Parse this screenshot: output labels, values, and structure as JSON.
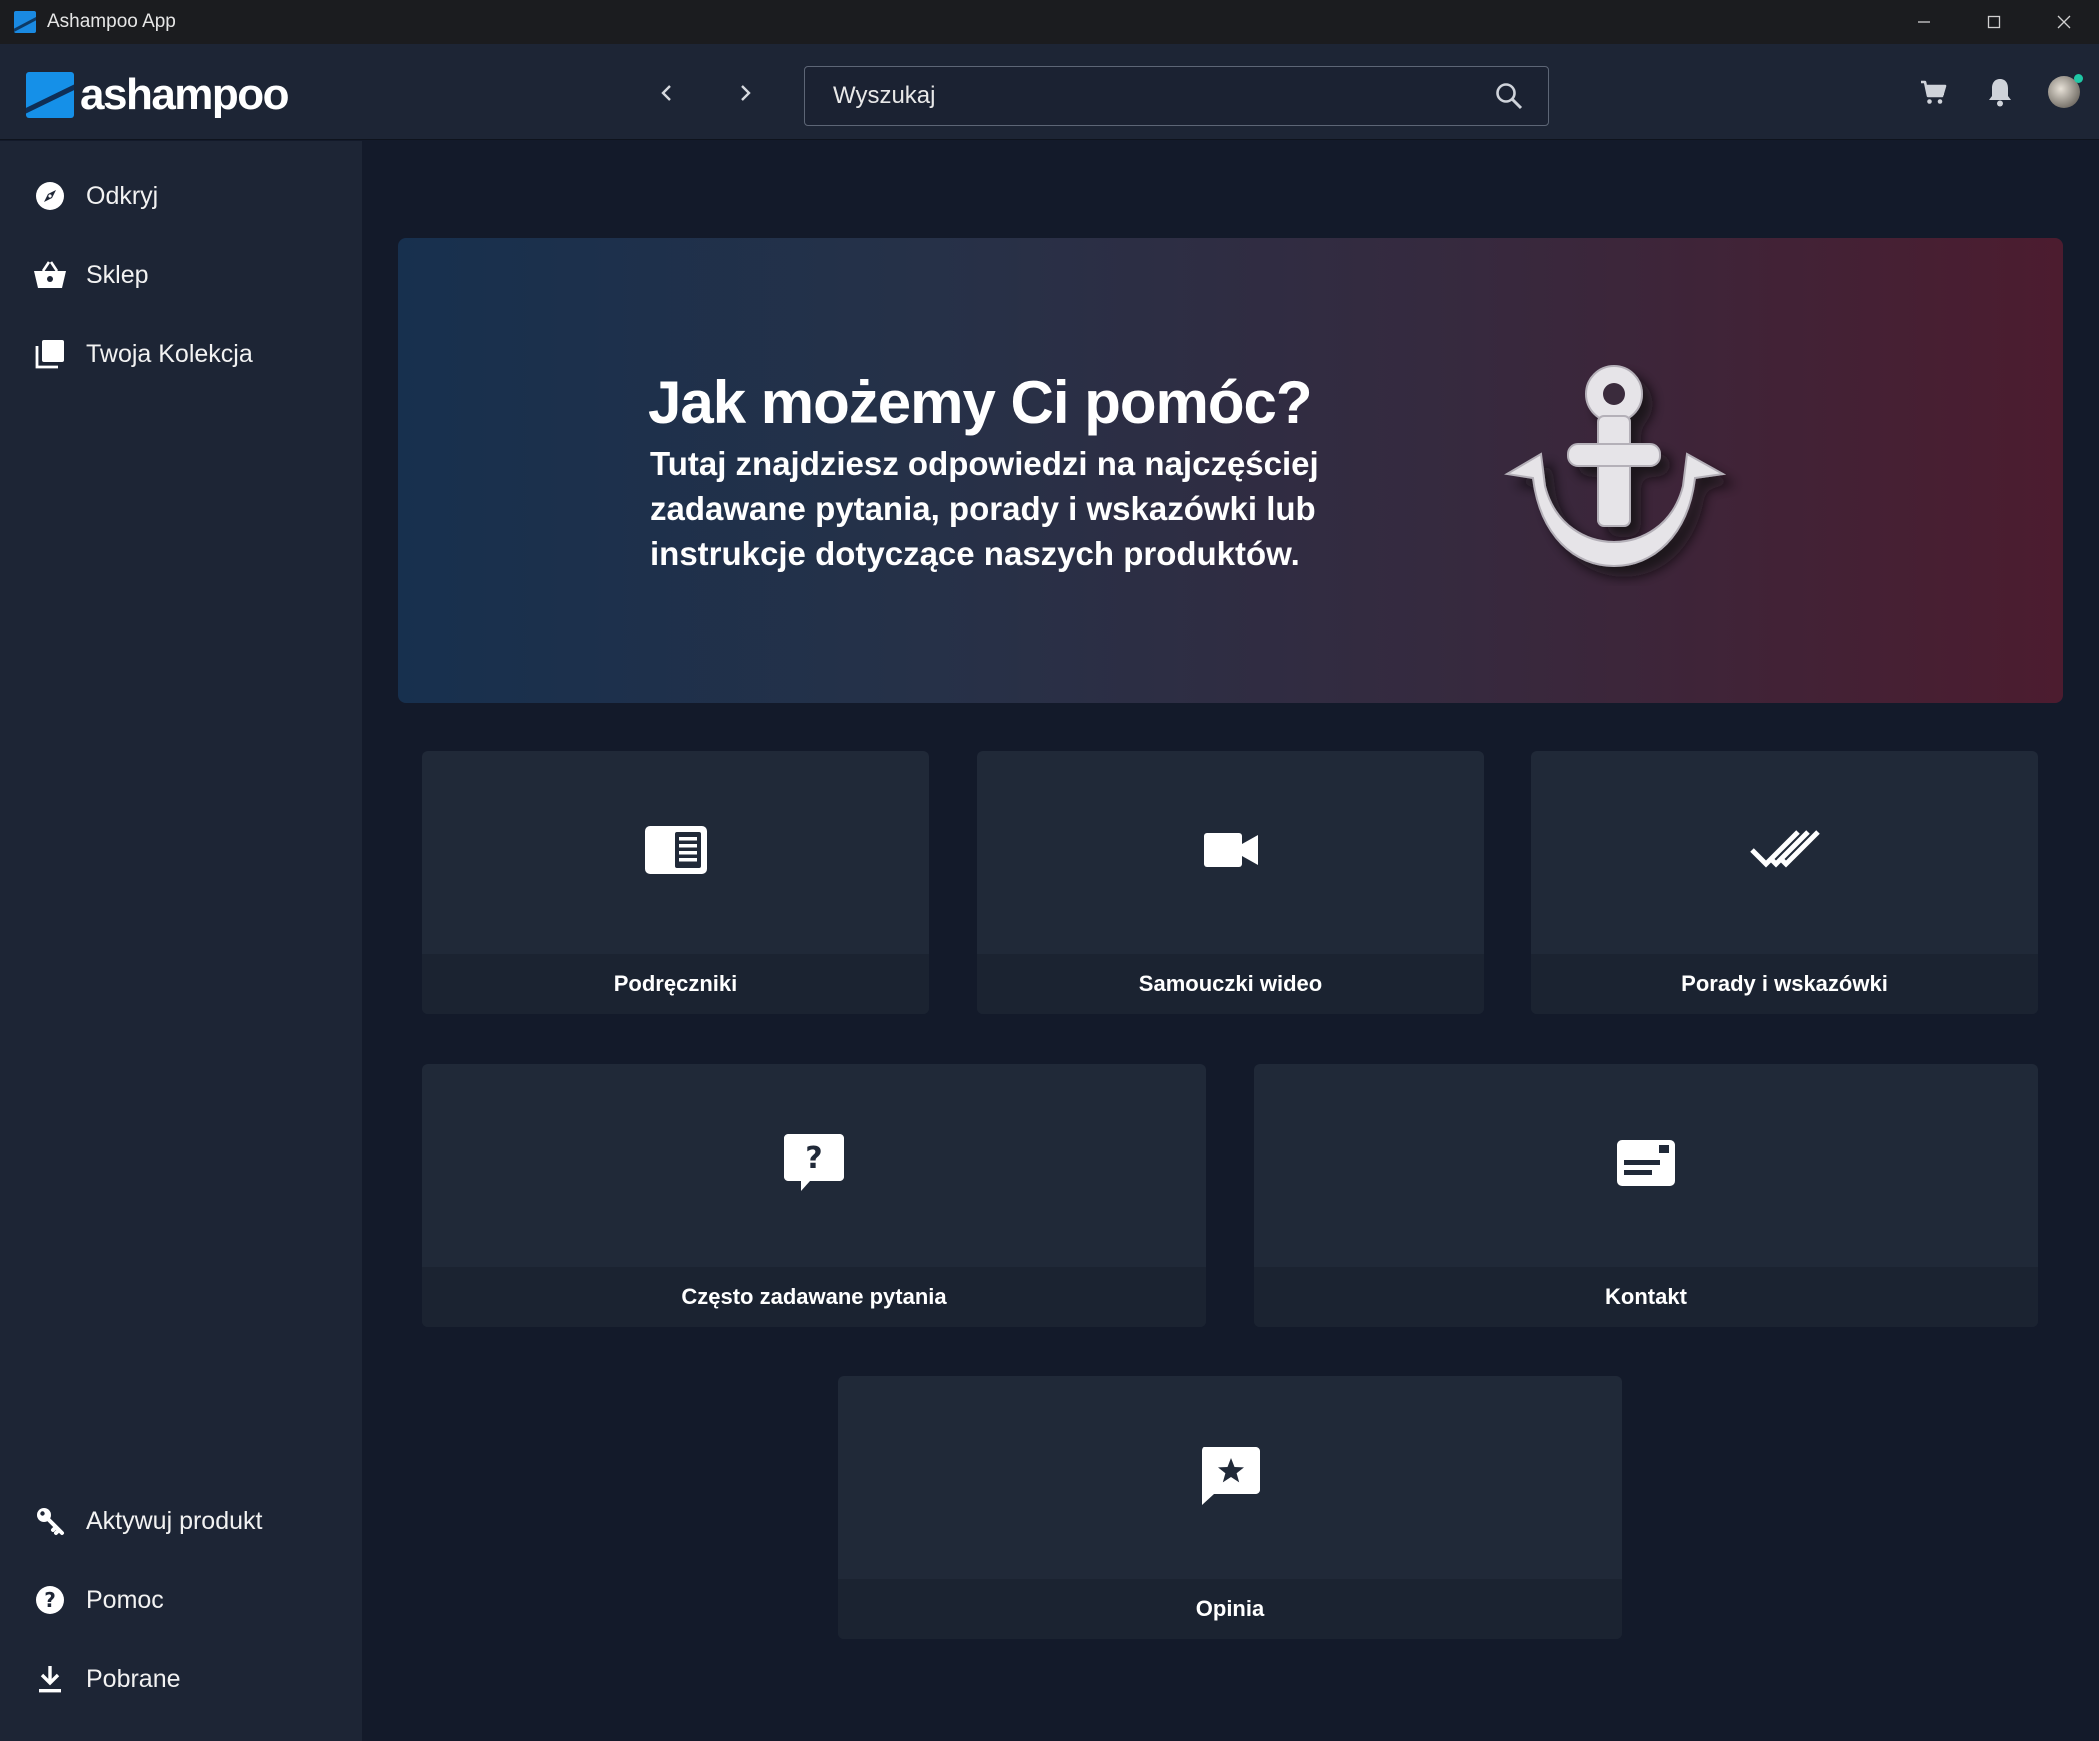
{
  "window": {
    "title": "Ashampoo App",
    "controls": [
      "minimize-icon",
      "maximize-icon",
      "close-icon"
    ]
  },
  "header": {
    "logo_text": "ashampoo",
    "search": {
      "placeholder": "Wyszukaj",
      "value": ""
    },
    "icons": [
      "back-arrow-icon",
      "forward-arrow-icon",
      "search-icon",
      "cart-icon",
      "bell-icon",
      "avatar"
    ]
  },
  "sidebar": {
    "top_items": [
      {
        "label": "Odkryj",
        "icon": "compass-icon"
      },
      {
        "label": "Sklep",
        "icon": "basket-icon"
      },
      {
        "label": "Twoja Kolekcja",
        "icon": "collection-icon"
      }
    ],
    "bottom_items": [
      {
        "label": "Aktywuj produkt",
        "icon": "key-icon"
      },
      {
        "label": "Pomoc",
        "icon": "help-icon"
      },
      {
        "label": "Pobrane",
        "icon": "download-icon"
      }
    ]
  },
  "hero": {
    "title": "Jak możemy Ci pomóc?",
    "subtitle": "Tutaj znajdziesz odpowiedzi na najczęściej zadawane pytania, porady i wskazówki lub instrukcje dotyczące naszych produktów.",
    "image": "anchor-icon"
  },
  "cards": [
    {
      "label": "Podręczniki",
      "icon": "manual-icon"
    },
    {
      "label": "Samouczki wideo",
      "icon": "video-camera-icon"
    },
    {
      "label": "Porady i wskazówki",
      "icon": "double-check-icon"
    },
    {
      "label": "Często zadawane pytania",
      "icon": "faq-icon"
    },
    {
      "label": "Kontakt",
      "icon": "contact-icon"
    },
    {
      "label": "Opinia",
      "icon": "feedback-star-icon"
    }
  ],
  "colors": {
    "background": "#131a2a",
    "panel": "#1d2535",
    "card": "#202938",
    "brand_blue": "#1590e8",
    "online_dot": "#1fc7a5"
  }
}
